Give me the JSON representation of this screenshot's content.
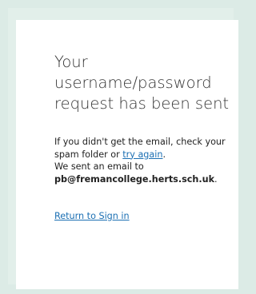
{
  "confirmation": {
    "heading": "Your username/password request has been sent",
    "line1_prefix": "If you didn't get the email, check your spam folder or ",
    "try_again_link": "try again",
    "line1_suffix": ".",
    "line2_prefix": "We sent an email to ",
    "email": "pb@fremancollege.herts.sch.uk",
    "line2_suffix": ".",
    "return_link": "Return to Sign in"
  },
  "colors": {
    "background": "#dcebe6",
    "card": "#ffffff",
    "link": "#1b6fb3",
    "text": "#333333"
  }
}
